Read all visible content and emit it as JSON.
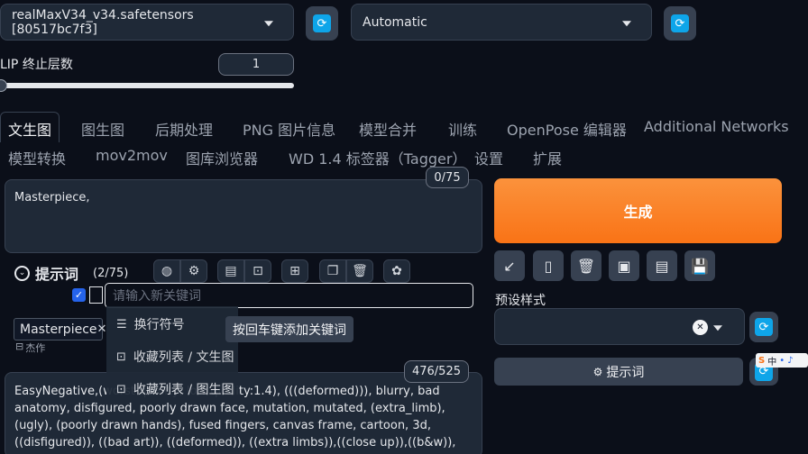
{
  "top": {
    "model_select": "realMaxV34_v34.safetensors [80517bc7f3]",
    "vae_select": "Automatic",
    "refresh_icon": "refresh-icon"
  },
  "clip": {
    "label": "LIP 终止层数",
    "value": "1",
    "slider_fraction": 0.0
  },
  "tabs_row1": [
    "文生图",
    "图生图",
    "后期处理",
    "PNG 图片信息",
    "模型合并",
    "训练",
    "OpenPose 编辑器",
    "Additional Networks"
  ],
  "tabs_row2": [
    "模型转换",
    "mov2mov",
    "图库浏览器",
    "WD 1.4 标签器（Tagger）",
    "设置",
    "扩展"
  ],
  "prompt": {
    "text": "Masterpiece,",
    "token_count": "0/75",
    "helper_title": "提示词",
    "helper_count": "(2/75)",
    "keyword_placeholder": "请输入新关键词",
    "tag_chip": "Masterpiece",
    "tag_sub": "杰作",
    "tooltip": "按回车键添加关键词"
  },
  "dropdown_menu": [
    "换行符号",
    "收藏列表 / 文生图",
    "收藏列表 / 图生图"
  ],
  "negative": {
    "token_count": "476/525",
    "text": "EasyNegative,(worst quality, low quality:1.4), (((deformed))), blurry, bad anatomy, disfigured, poorly drawn face, mutation, mutated, (extra_limb), (ugly), (poorly drawn hands), fused fingers, canvas frame, cartoon, 3d, ((disfigured)), ((bad art)), ((deformed)), ((extra limbs)),((close up)),((b&w)), wierd colors, blurry, (((duplicate)), ((morbid)),"
  },
  "right": {
    "generate_label": "生成",
    "style_label": "预设样式",
    "prompt_button": "提示词",
    "ime_label": "中"
  },
  "colors": {
    "accent": "#f97316",
    "refresh": "#0ea5e9",
    "bg": "#0b0f19"
  }
}
